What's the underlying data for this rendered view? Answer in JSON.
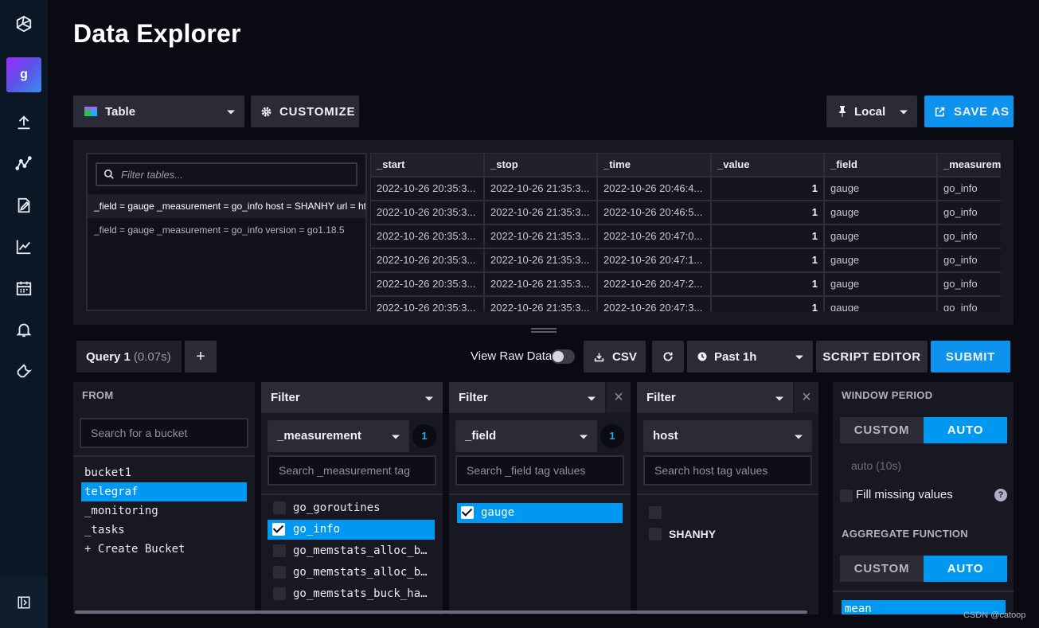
{
  "page": {
    "title": "Data Explorer"
  },
  "sidebar": {
    "org_initial": "g",
    "icons": [
      "influx-logo-icon",
      "upload-icon",
      "graph-icon",
      "notebook-icon",
      "chart-line-icon",
      "calendar-icon",
      "bell-icon",
      "wrench-icon"
    ],
    "collapse_icon": "expand-sidebar-icon"
  },
  "toolbar": {
    "viz_type": "Table",
    "customize_label": "CUSTOMIZE",
    "timezone": "Local",
    "save_as_label": "SAVE AS"
  },
  "results": {
    "filter_placeholder": "Filter tables...",
    "tables": [
      "_field = gauge _measurement = go_info host = SHANHY url = http",
      "_field = gauge _measurement = go_info version = go1.18.5"
    ],
    "columns": [
      "_start",
      "_stop",
      "_time",
      "_value",
      "_field",
      "_measurement"
    ],
    "rows": [
      [
        "2022-10-26 20:35:3...",
        "2022-10-26 21:35:3...",
        "2022-10-26 20:46:4...",
        "1",
        "gauge",
        "go_info"
      ],
      [
        "2022-10-26 20:35:3...",
        "2022-10-26 21:35:3...",
        "2022-10-26 20:46:5...",
        "1",
        "gauge",
        "go_info"
      ],
      [
        "2022-10-26 20:35:3...",
        "2022-10-26 21:35:3...",
        "2022-10-26 20:47:0...",
        "1",
        "gauge",
        "go_info"
      ],
      [
        "2022-10-26 20:35:3...",
        "2022-10-26 21:35:3...",
        "2022-10-26 20:47:1...",
        "1",
        "gauge",
        "go_info"
      ],
      [
        "2022-10-26 20:35:3...",
        "2022-10-26 21:35:3...",
        "2022-10-26 20:47:2...",
        "1",
        "gauge",
        "go_info"
      ],
      [
        "2022-10-26 20:35:3...",
        "2022-10-26 21:35:3...",
        "2022-10-26 20:47:3...",
        "1",
        "gauge",
        "go_info"
      ]
    ]
  },
  "query_bar": {
    "tab_name": "Query 1",
    "tab_time": "(0.07s)",
    "add_label": "+",
    "view_raw_label": "View Raw Data",
    "raw_data_on": false,
    "csv_label": "CSV",
    "time_range": "Past 1h",
    "script_editor_label": "SCRIPT EDITOR",
    "submit_label": "SUBMIT"
  },
  "from": {
    "title": "FROM",
    "search_placeholder": "Search for a bucket",
    "buckets": [
      "bucket1",
      "telegraf",
      "_monitoring",
      "_tasks",
      "+ Create Bucket"
    ],
    "selected": "telegraf"
  },
  "filters": [
    {
      "header": "Filter",
      "key": "_measurement",
      "count": "1",
      "search_placeholder": "Search _measurement tag",
      "values": [
        {
          "label": "go_goroutines",
          "checked": false
        },
        {
          "label": "go_info",
          "checked": true
        },
        {
          "label": "go_memstats_alloc_b…",
          "checked": false
        },
        {
          "label": "go_memstats_alloc_b…",
          "checked": false
        },
        {
          "label": "go_memstats_buck_ha…",
          "checked": false
        }
      ]
    },
    {
      "header": "Filter",
      "key": "_field",
      "count": "1",
      "search_placeholder": "Search _field tag values",
      "values": [
        {
          "label": "gauge",
          "checked": true
        }
      ]
    },
    {
      "header": "Filter",
      "key": "host",
      "count": "",
      "search_placeholder": "Search host tag values",
      "values": [
        {
          "label": "",
          "checked": false
        },
        {
          "label": "SHANHY",
          "checked": false
        }
      ]
    }
  ],
  "window": {
    "window_title": "WINDOW PERIOD",
    "custom_label": "CUSTOM",
    "auto_label": "AUTO",
    "auto_value": "auto (10s)",
    "fill_missing_label": "Fill missing values",
    "help_label": "?",
    "aggregate_title": "AGGREGATE FUNCTION",
    "agg_custom_label": "CUSTOM",
    "agg_auto_label": "AUTO",
    "functions": [
      "mean"
    ]
  },
  "watermark": "CSDN @catoop",
  "colors": {
    "accent": "#0098f0",
    "background": "#0a0a13",
    "panel": "#181822",
    "sidebar": "#0b1724"
  }
}
